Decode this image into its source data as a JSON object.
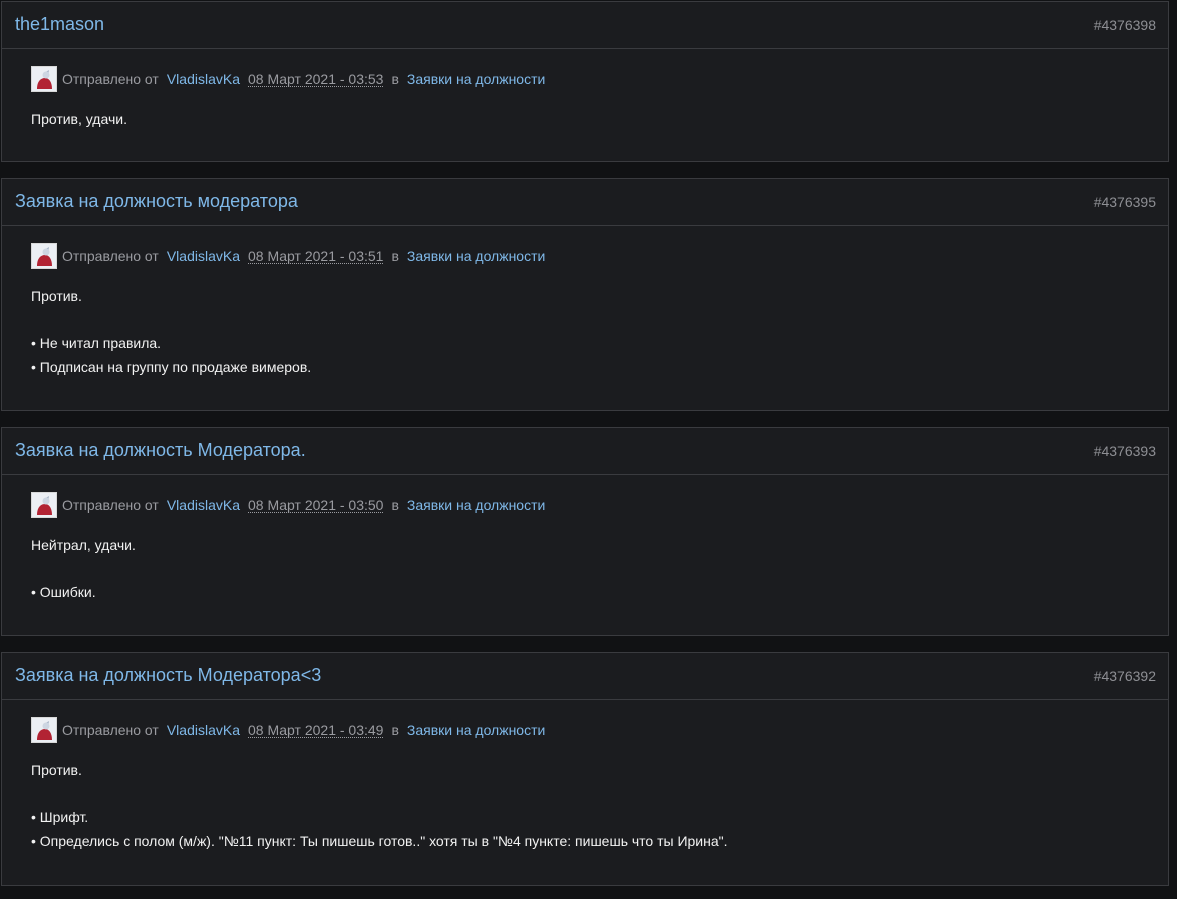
{
  "posts": [
    {
      "title": "the1mason",
      "id": "#4376398",
      "sent_label": "Отправлено от",
      "author": "VladislavKa",
      "date": "08 Март 2021 - 03:53",
      "in_label": "в",
      "forum": "Заявки на должности",
      "body": [
        "Против, удачи."
      ]
    },
    {
      "title": "Заявка на должность модератора",
      "id": "#4376395",
      "sent_label": "Отправлено от",
      "author": "VladislavKa",
      "date": "08 Март 2021 - 03:51",
      "in_label": "в",
      "forum": "Заявки на должности",
      "body": [
        "Против.",
        "• Не читал правила.",
        "• Подписан на группу по продаже вимеров."
      ]
    },
    {
      "title": "Заявка на должность Модератора.",
      "id": "#4376393",
      "sent_label": "Отправлено от",
      "author": "VladislavKa",
      "date": "08 Март 2021 - 03:50",
      "in_label": "в",
      "forum": "Заявки на должности",
      "body": [
        "Нейтрал, удачи.",
        "• Ошибки."
      ]
    },
    {
      "title": "Заявка на должность Модератора<3",
      "id": "#4376392",
      "sent_label": "Отправлено от",
      "author": "VladislavKa",
      "date": "08 Март 2021 - 03:49",
      "in_label": "в",
      "forum": "Заявки на должности",
      "body": [
        "Против.",
        "• Шрифт.",
        "• Определись с полом (м/ж). \"№11 пункт: Ты пишешь готов..\" хотя ты в \"№4 пункте: пишешь что ты Ирина\"."
      ]
    }
  ]
}
